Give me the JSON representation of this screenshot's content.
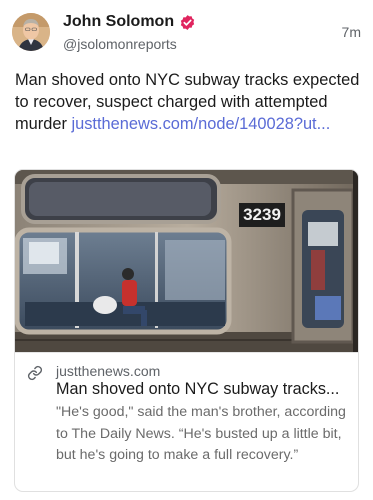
{
  "post": {
    "author_name": "John Solomon",
    "handle": "@jsolomonreports",
    "time": "7m",
    "text": "Man shoved onto NYC subway tracks expected to recover, suspect charged with attempted murder",
    "link_text": "justthenews.com/node/140028?ut..."
  },
  "card": {
    "domain": "justthenews.com",
    "title": "Man shoved onto NYC subway tracks...",
    "description": "\"He's good,\" said the man's brother, according to The Daily News. “He's busted up a little bit, but he's going to make a full recovery.”",
    "image_car_number": "3239"
  },
  "icons": {
    "verified": "verified-badge-icon",
    "link": "link-icon"
  },
  "colors": {
    "verified_badge": "#e0245e",
    "link": "#5a6bd6"
  }
}
